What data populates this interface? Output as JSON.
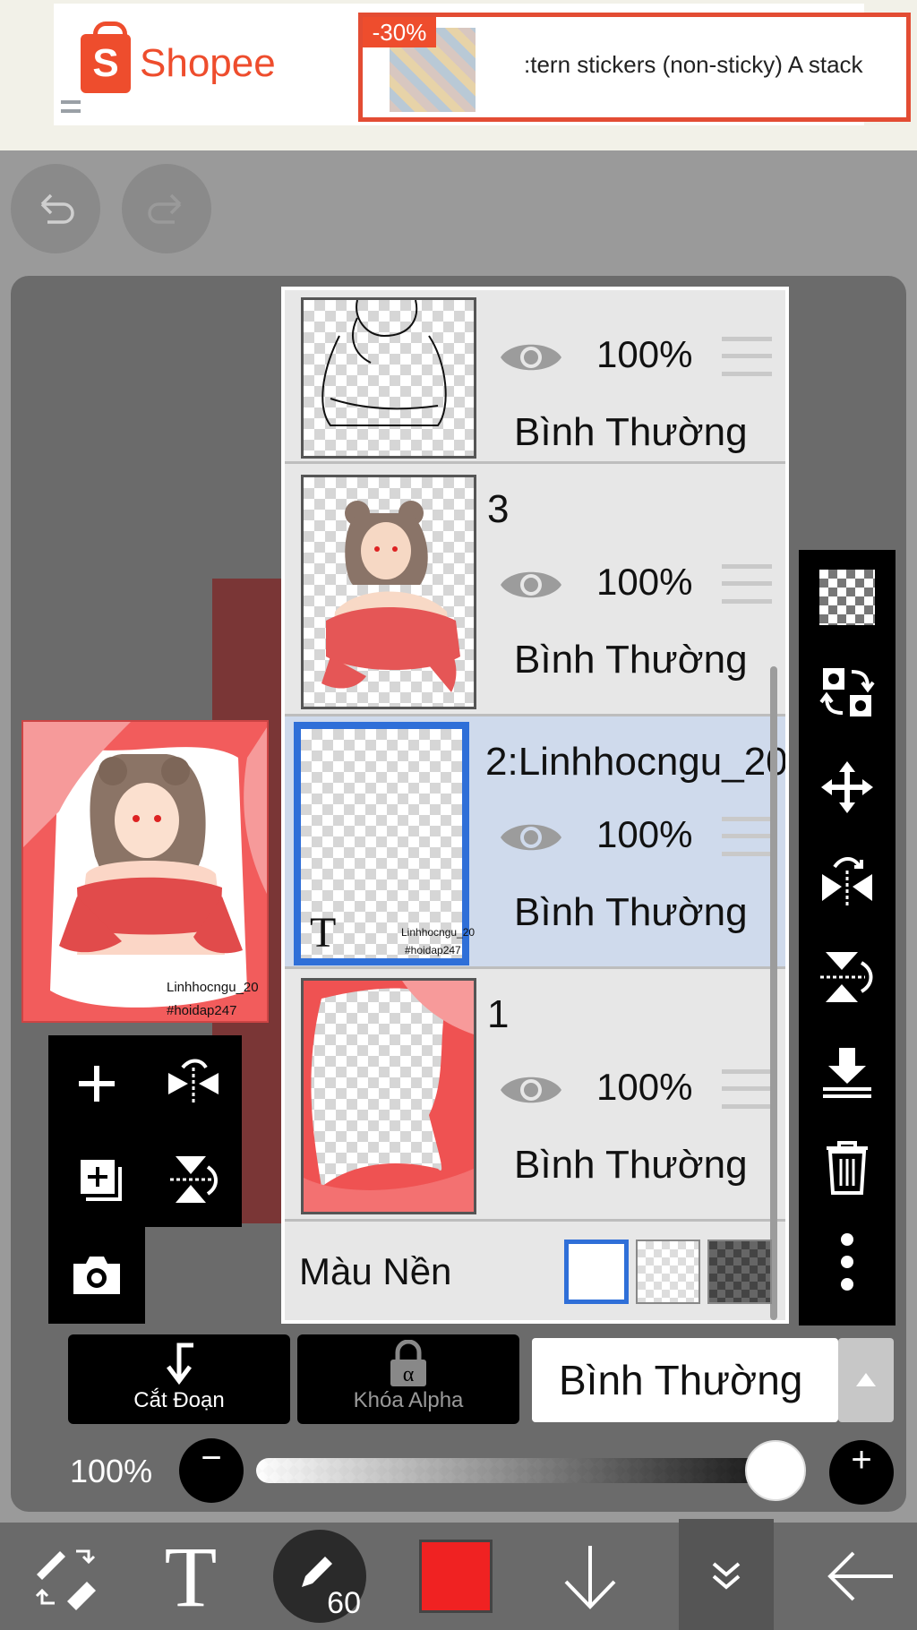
{
  "ad": {
    "brand": "Shopee",
    "discount": "-30%",
    "product_text": ":tern stickers (non-sticky)    A stack"
  },
  "preview": {
    "line1": "Linhhocngu_20",
    "line2": "#hoidap247"
  },
  "layers": {
    "items": [
      {
        "name": "",
        "opacity": "100%",
        "blend": "Bình Thường",
        "visible": true,
        "selected": false
      },
      {
        "name": "3",
        "opacity": "100%",
        "blend": "Bình Thường",
        "visible": true,
        "selected": false
      },
      {
        "name": "2:Linhhocngu_20",
        "opacity": "100%",
        "blend": "Bình Thường",
        "visible": true,
        "selected": true,
        "thumb_text_1": "Linhhocngu_20",
        "thumb_text_2": "#hoidap247",
        "type_glyph": "T"
      },
      {
        "name": "1",
        "opacity": "100%",
        "blend": "Bình Thường",
        "visible": true,
        "selected": false
      }
    ],
    "background_label": "Màu Nền"
  },
  "controls": {
    "clip_label": "Cắt Đoạn",
    "alpha_lock_label": "Khóa Alpha",
    "blend_mode": "Bình Thường",
    "opacity_label": "100%",
    "opacity_value": 1.0
  },
  "toolbar": {
    "brush_size": "60",
    "text_glyph": "T",
    "current_color": "#f02222"
  },
  "icons": [
    "undo-icon",
    "redo-icon",
    "add-layer-icon",
    "flip-horizontal-icon",
    "add-layer-copy-icon",
    "flip-vertical-icon",
    "camera-icon",
    "transparency-icon",
    "transfer-icon",
    "move-icon",
    "trash-icon",
    "more-icon",
    "merge-down-icon",
    "lock-icon"
  ]
}
